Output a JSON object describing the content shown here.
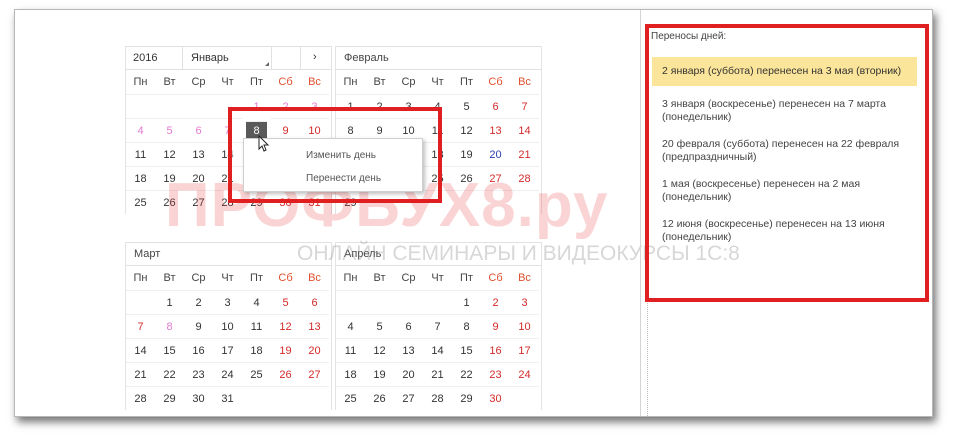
{
  "calendar": {
    "year": "2016",
    "weekdays": [
      "Пн",
      "Вт",
      "Ср",
      "Чт",
      "Пт",
      "Сб",
      "Вс"
    ],
    "months": {
      "jan": {
        "name": "Январь",
        "next": "›"
      },
      "feb": {
        "name": "Февраль"
      },
      "mar": {
        "name": "Март"
      },
      "apr": {
        "name": "Апрель"
      }
    },
    "jan_rows": [
      [
        "",
        "",
        "",
        "",
        "1",
        "2",
        "3"
      ],
      [
        "4",
        "5",
        "6",
        "7",
        "8",
        "9",
        "10"
      ],
      [
        "11",
        "12",
        "13",
        "14",
        "15",
        "16",
        "17"
      ],
      [
        "18",
        "19",
        "20",
        "21",
        "22",
        "23",
        "24"
      ],
      [
        "25",
        "26",
        "27",
        "28",
        "29",
        "30",
        "31"
      ]
    ],
    "feb_rows": [
      [
        "1",
        "2",
        "3",
        "4",
        "5",
        "6",
        "7"
      ],
      [
        "8",
        "9",
        "10",
        "11",
        "12",
        "13",
        "14"
      ],
      [
        "15",
        "16",
        "17",
        "18",
        "19",
        "20",
        "21"
      ],
      [
        "22",
        "23",
        "24",
        "25",
        "26",
        "27",
        "28"
      ],
      [
        "29",
        "",
        "",
        "",
        "",
        "",
        ""
      ]
    ],
    "mar_rows": [
      [
        "",
        "1",
        "2",
        "3",
        "4",
        "5",
        "6"
      ],
      [
        "7",
        "8",
        "9",
        "10",
        "11",
        "12",
        "13"
      ],
      [
        "14",
        "15",
        "16",
        "17",
        "18",
        "19",
        "20"
      ],
      [
        "21",
        "22",
        "23",
        "24",
        "25",
        "26",
        "27"
      ],
      [
        "28",
        "29",
        "30",
        "31",
        "",
        "",
        ""
      ]
    ],
    "apr_rows": [
      [
        "",
        "",
        "",
        "",
        "1",
        "2",
        "3"
      ],
      [
        "4",
        "5",
        "6",
        "7",
        "8",
        "9",
        "10"
      ],
      [
        "11",
        "12",
        "13",
        "14",
        "15",
        "16",
        "17"
      ],
      [
        "18",
        "19",
        "20",
        "21",
        "22",
        "23",
        "24"
      ],
      [
        "25",
        "26",
        "27",
        "28",
        "29",
        "30",
        ""
      ]
    ],
    "selected_day": "8"
  },
  "context_menu": {
    "change_day": "Изменить день",
    "move_day": "Перенести день"
  },
  "transfers": {
    "label": "Переносы дней:",
    "items": [
      "2 января (суббота) перенесен на 3 мая (вторник)",
      "3 января (воскресенье) перенесен на 7 марта (понедельник)",
      "20 февраля (суббота) перенесен на 22 февраля (предпраздничный)",
      "1 мая (воскресенье) перенесен на 2 мая (понедельник)",
      "12 июня (воскресенье) перенесен на 13 июня (понедельник)"
    ]
  },
  "watermark": {
    "brand": "ПРОФБУХ8.ру",
    "tagline": "ОНЛАЙН СЕМИНАРЫ И ВИДЕОКУРСЫ 1С:8"
  },
  "colors": {
    "weekend": "#e0502f",
    "holiday": "#d42a2a",
    "highlight": "#fbe59a",
    "annotation": "#e02020"
  }
}
